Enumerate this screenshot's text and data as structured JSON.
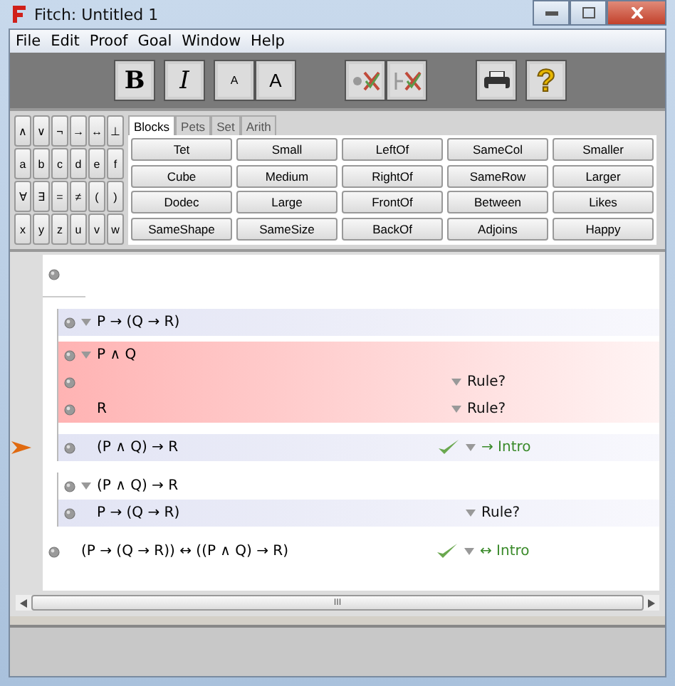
{
  "window": {
    "title": "Fitch: Untitled 1"
  },
  "menu": [
    "File",
    "Edit",
    "Proof",
    "Goal",
    "Window",
    "Help"
  ],
  "toolbar": [
    {
      "kind": "bold",
      "label": "B"
    },
    {
      "kind": "italic",
      "label": "I"
    },
    {
      "kind": "small",
      "label": "A"
    },
    {
      "kind": "large",
      "label": "A"
    },
    {
      "kind": "add-goal"
    },
    {
      "kind": "remove-goal"
    },
    {
      "kind": "print"
    },
    {
      "kind": "help",
      "label": "?"
    }
  ],
  "symbols": [
    [
      "∧",
      "∨",
      "¬",
      "→",
      "↔",
      "⊥"
    ],
    [
      "a",
      "b",
      "c",
      "d",
      "e",
      "f"
    ],
    [
      "∀",
      "∃",
      "=",
      "≠",
      "(",
      ")"
    ],
    [
      "x",
      "y",
      "z",
      "u",
      "v",
      "w"
    ]
  ],
  "tabs": [
    {
      "label": "Blocks",
      "selected": true
    },
    {
      "label": "Pets",
      "selected": false
    },
    {
      "label": "Set",
      "selected": false
    },
    {
      "label": "Arith",
      "selected": false
    }
  ],
  "predicates": [
    [
      "Tet",
      "Small",
      "LeftOf",
      "SameCol",
      "Smaller"
    ],
    [
      "Cube",
      "Medium",
      "RightOf",
      "SameRow",
      "Larger"
    ],
    [
      "Dodec",
      "Large",
      "FrontOf",
      "Between",
      "Likes"
    ],
    [
      "SameShape",
      "SameSize",
      "BackOf",
      "Adjoins",
      "Happy"
    ]
  ],
  "proof": {
    "premises": [
      {
        "shaded": false
      }
    ],
    "steps": [
      {
        "kind": "subproof",
        "highlighted": false,
        "assumption": {
          "text": "P → (Q → R)",
          "shaded": true
        },
        "steps": [
          {
            "kind": "subproof",
            "highlighted": true,
            "assumption": {
              "text": "P ∧ Q",
              "shaded": false
            },
            "steps": [
              {
                "kind": "step",
                "rule": "Rule?",
                "verified": false,
                "current": false,
                "shaded": false
              },
              {
                "kind": "step",
                "text": "R",
                "rule": "Rule?",
                "verified": false,
                "current": false,
                "shaded": false
              }
            ]
          },
          {
            "kind": "step",
            "text": "(P ∧ Q) → R",
            "rule": "→ Intro",
            "verified": true,
            "current": true,
            "shaded": true
          }
        ]
      },
      {
        "kind": "subproof",
        "highlighted": false,
        "assumption": {
          "text": "(P ∧ Q) → R",
          "shaded": false
        },
        "steps": [
          {
            "kind": "step",
            "text": "P → (Q → R)",
            "rule": "Rule?",
            "verified": false,
            "current": false,
            "shaded": true
          }
        ]
      },
      {
        "kind": "step",
        "text": "(P → (Q → R)) ↔ ((P ∧ Q) → R)",
        "rule": "↔ Intro",
        "verified": true,
        "current": false,
        "shaded": false
      }
    ]
  },
  "scrollbar": {
    "grip": "III"
  }
}
